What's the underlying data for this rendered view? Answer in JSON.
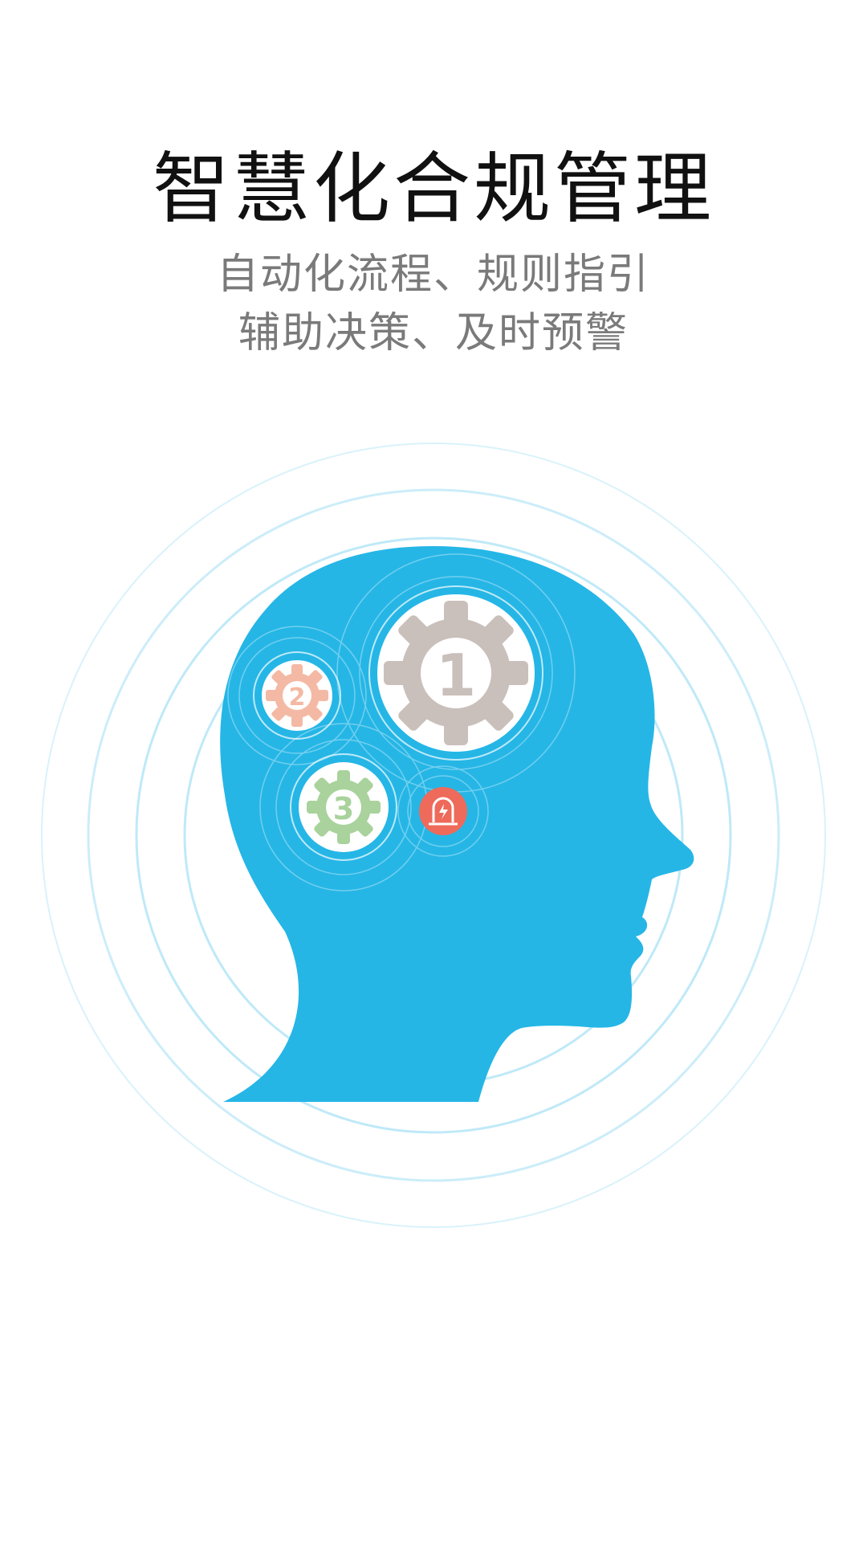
{
  "screen": {
    "title": "智慧化合规管理",
    "subtitle_lines": [
      "自动化流程、规则指引",
      "辅助决策、及时预警"
    ]
  },
  "illustration": {
    "gears": [
      {
        "label": "1",
        "icon": "gear-icon",
        "color": "#c9bfbb"
      },
      {
        "label": "2",
        "icon": "gear-icon",
        "color": "#f4b9a4"
      },
      {
        "label": "3",
        "icon": "gear-icon",
        "color": "#a9d29c"
      }
    ],
    "alarm": {
      "icon": "alarm-light-icon",
      "color": "#ee6a5a"
    },
    "colors": {
      "head": "#25b6e6",
      "rings": "#bfe9f8",
      "title": "#111111",
      "subtitle": "#7a7a7a"
    }
  }
}
